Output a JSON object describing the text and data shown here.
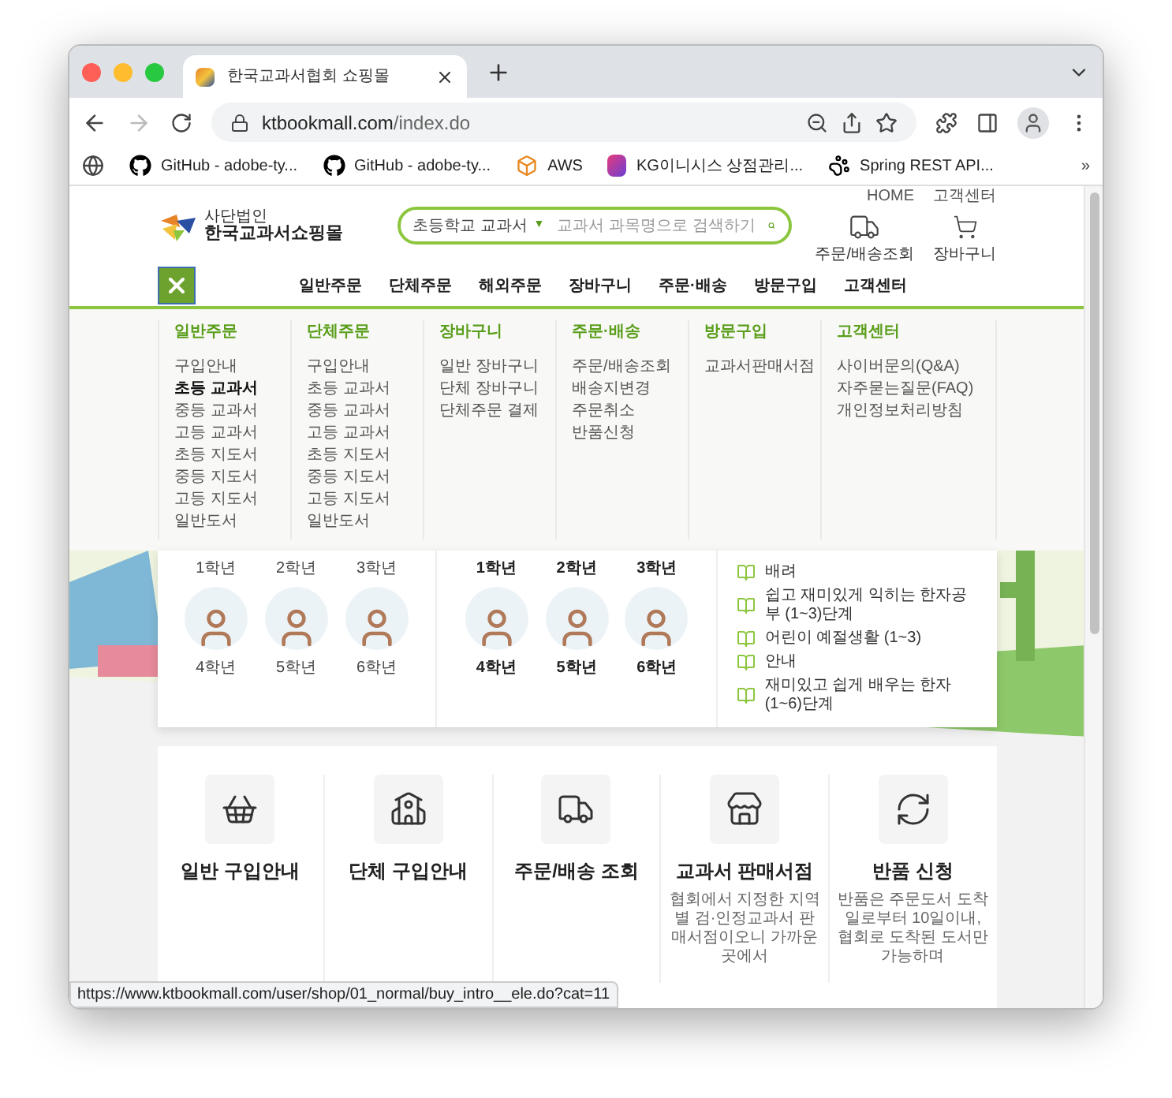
{
  "browser": {
    "tab_title": "한국교과서협회 쇼핑몰",
    "url_host": "ktbookmall.com",
    "url_path": "/index.do",
    "bookmarks": [
      {
        "kind": "github",
        "label": "GitHub - adobe-ty..."
      },
      {
        "kind": "github",
        "label": "GitHub - adobe-ty..."
      },
      {
        "kind": "aws",
        "label": "AWS"
      },
      {
        "kind": "kg",
        "label": "KG이니시스 상점관리..."
      },
      {
        "kind": "paw",
        "label": "Spring REST API..."
      }
    ],
    "more": "»"
  },
  "header": {
    "logo_small": "사단법인",
    "logo": "한국교과서쇼핑몰",
    "search": {
      "category": "초등학교 교과서",
      "caret": "▼",
      "placeholder": "교과서 과목명으로 검색하기"
    },
    "top_links": [
      "HOME",
      "고객센터"
    ],
    "quick_links": [
      {
        "kind": "truck",
        "label": "주문/배송조회"
      },
      {
        "kind": "cart",
        "label": "장바구니"
      }
    ]
  },
  "nav": {
    "items": [
      "일반주문",
      "단체주문",
      "해외주문",
      "장바구니",
      "주문·배송",
      "방문구입",
      "고객센터"
    ]
  },
  "mega_menu": {
    "columns": [
      {
        "title": "일반주문",
        "items": [
          {
            "label": "구입안내",
            "selected": false
          },
          {
            "label": "초등 교과서",
            "selected": true
          },
          {
            "label": "중등 교과서",
            "selected": false
          },
          {
            "label": "고등 교과서",
            "selected": false
          },
          {
            "label": "초등 지도서",
            "selected": false
          },
          {
            "label": "중등 지도서",
            "selected": false
          },
          {
            "label": "고등 지도서",
            "selected": false
          },
          {
            "label": "일반도서",
            "selected": false
          }
        ]
      },
      {
        "title": "단체주문",
        "items": [
          {
            "label": "구입안내",
            "selected": false
          },
          {
            "label": "초등 교과서",
            "selected": false
          },
          {
            "label": "중등 교과서",
            "selected": false
          },
          {
            "label": "고등 교과서",
            "selected": false
          },
          {
            "label": "초등 지도서",
            "selected": false
          },
          {
            "label": "중등 지도서",
            "selected": false
          },
          {
            "label": "고등 지도서",
            "selected": false
          },
          {
            "label": "일반도서",
            "selected": false
          }
        ]
      },
      {
        "title": "장바구니",
        "items": [
          {
            "label": "일반 장바구니",
            "selected": false
          },
          {
            "label": "단체 장바구니",
            "selected": false
          },
          {
            "label": "단체주문 결제",
            "selected": false
          }
        ]
      },
      {
        "title": "주문·배송",
        "items": [
          {
            "label": "주문/배송조회",
            "selected": false
          },
          {
            "label": "배송지변경",
            "selected": false
          },
          {
            "label": "주문취소",
            "selected": false
          },
          {
            "label": "반품신청",
            "selected": false
          }
        ]
      },
      {
        "title": "방문구입",
        "items": [
          {
            "label": "교과서판매서점",
            "selected": false
          }
        ]
      },
      {
        "title": "고객센터",
        "items": [
          {
            "label": "사이버문의(Q&A)",
            "selected": false
          },
          {
            "label": "자주묻는질문(FAQ)",
            "selected": false
          },
          {
            "label": "개인정보처리방침",
            "selected": false
          }
        ]
      }
    ]
  },
  "grade_panels": [
    {
      "highlighted": false,
      "top": [
        "1학년",
        "2학년",
        "3학년"
      ],
      "bottom": [
        "4학년",
        "5학년",
        "6학년"
      ]
    },
    {
      "highlighted": true,
      "top": [
        "1학년",
        "2학년",
        "3학년"
      ],
      "bottom": [
        "4학년",
        "5학년",
        "6학년"
      ]
    }
  ],
  "book_list": [
    "배려",
    "쉽고 재미있게 익히는 한자공부 (1~3)단계",
    "어린이 예절생활 (1~3)",
    "안내",
    "재미있고 쉽게 배우는 한자 (1~6)단계"
  ],
  "service_cards": [
    {
      "kind": "basket",
      "title": "일반 구입안내"
    },
    {
      "kind": "school",
      "title": "단체 구입안내"
    },
    {
      "kind": "truck",
      "title": "주문/배송 조회"
    },
    {
      "kind": "store",
      "title": "교과서 판매서점",
      "description": "협회에서 지정한 지역별 검·인정교과서 판매서점이오니 가까운 곳에서"
    },
    {
      "kind": "refresh",
      "title": "반품 신청",
      "description": "반품은 주문도서 도착일로부터 10일이내, 협회로 도착된 도서만 가능하며"
    }
  ],
  "status_url": "https://www.ktbookmall.com/user/shop/01_normal/buy_intro__ele.do?cat=11"
}
